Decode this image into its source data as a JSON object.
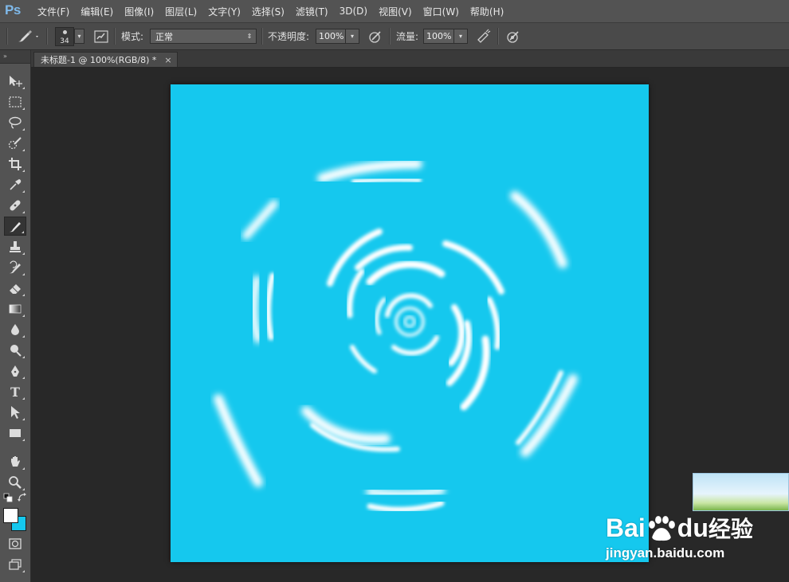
{
  "app": {
    "logo": "Ps"
  },
  "menu": [
    "文件(F)",
    "编辑(E)",
    "图像(I)",
    "图层(L)",
    "文字(Y)",
    "选择(S)",
    "滤镜(T)",
    "3D(D)",
    "视图(V)",
    "窗口(W)",
    "帮助(H)"
  ],
  "options": {
    "brush_size": "34",
    "mode_label": "模式:",
    "mode_value": "正常",
    "opacity_label": "不透明度:",
    "opacity_value": "100%",
    "flow_label": "流量:",
    "flow_value": "100%"
  },
  "document": {
    "tab_title": "未标题-1 @ 100%(RGB/8) *",
    "close_glyph": "×",
    "canvas_color": "#15c8ee"
  },
  "colors": {
    "foreground": "#ffffff",
    "background": "#15c8ee"
  },
  "toolbox": {
    "tools": [
      "move-tool",
      "marquee-tool",
      "lasso-tool",
      "quick-selection-tool",
      "crop-tool",
      "eyedropper-tool",
      "healing-brush-tool",
      "brush-tool",
      "clone-stamp-tool",
      "history-brush-tool",
      "eraser-tool",
      "gradient-tool",
      "blur-tool",
      "dodge-tool",
      "pen-tool",
      "type-tool",
      "path-selection-tool",
      "rectangle-tool",
      "hand-tool",
      "zoom-tool"
    ],
    "active": "brush-tool",
    "type_glyph": "T"
  },
  "watermark": {
    "brand_left": "Bai",
    "brand_right": "du",
    "brand_suffix": "经验",
    "url": "jingyan.baidu.com"
  }
}
